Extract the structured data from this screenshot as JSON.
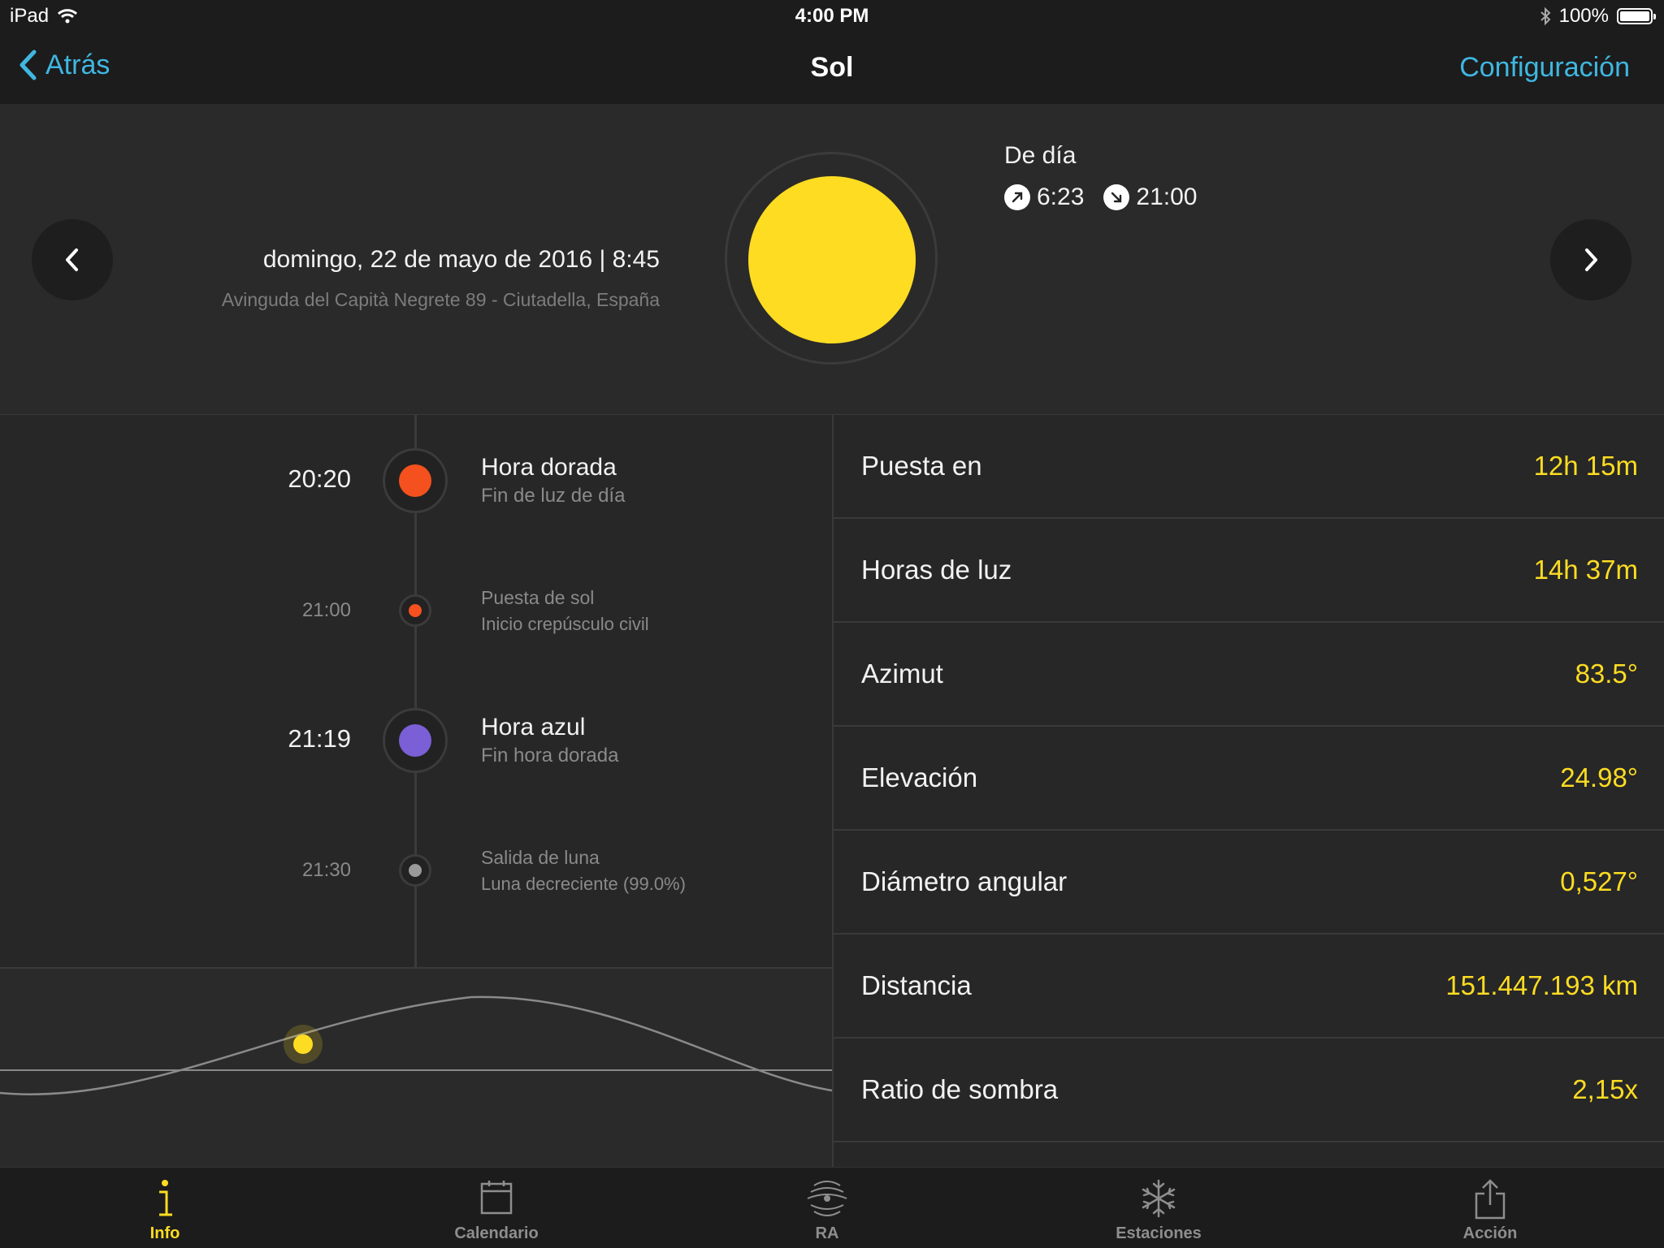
{
  "status_bar": {
    "device": "iPad",
    "time": "4:00 PM",
    "battery": "100%"
  },
  "nav": {
    "back_label": "Atrás",
    "title": "Sol",
    "config_label": "Configuración"
  },
  "header": {
    "date_time": "domingo, 22 de mayo de 2016 | 8:45",
    "address": "Avinguda del Capità Negrete 89 - Ciutadella, España",
    "phase": "De día",
    "sunrise": "6:23",
    "sunset": "21:00",
    "sun_color": "#fddc22"
  },
  "timeline": [
    {
      "time": "20:20",
      "title": "Hora dorada",
      "subtitle": "Fin de luz de día",
      "major": true,
      "color": "#f4511e"
    },
    {
      "time": "21:00",
      "title": "Puesta de sol",
      "subtitle": "Inicio crepúsculo civil",
      "major": false,
      "color": "#f4511e"
    },
    {
      "time": "21:19",
      "title": "Hora azul",
      "subtitle": "Fin hora dorada",
      "major": true,
      "color": "#7b5fd6"
    },
    {
      "time": "21:30",
      "title": "Salida de luna",
      "subtitle": "Luna decreciente (99.0%)",
      "major": false,
      "color": "#9a9a9a"
    }
  ],
  "info": [
    {
      "label": "Puesta en",
      "value": "12h 15m"
    },
    {
      "label": "Horas de luz",
      "value": "14h 37m"
    },
    {
      "label": "Azimut",
      "value": "83.5°"
    },
    {
      "label": "Elevación",
      "value": "24.98°"
    },
    {
      "label": "Diámetro angular",
      "value": "0,527°"
    },
    {
      "label": "Distancia",
      "value": "151.447.193 km"
    },
    {
      "label": "Ratio de sombra",
      "value": "2,15x"
    }
  ],
  "tabs": [
    {
      "label": "Info",
      "icon": "info-icon",
      "active": true
    },
    {
      "label": "Calendario",
      "icon": "calendar-icon",
      "active": false
    },
    {
      "label": "RA",
      "icon": "ar-icon",
      "active": false
    },
    {
      "label": "Estaciones",
      "icon": "snowflake-icon",
      "active": false
    },
    {
      "label": "Acción",
      "icon": "share-icon",
      "active": false
    }
  ],
  "colors": {
    "accent": "#3fb7e1",
    "value": "#fddc22",
    "background": "#272727"
  }
}
